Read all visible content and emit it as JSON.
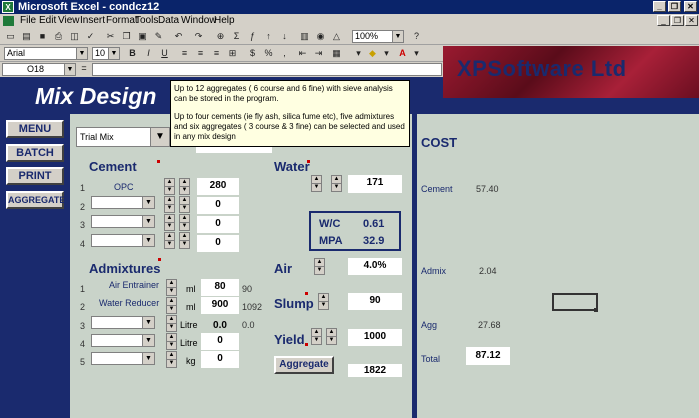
{
  "window": {
    "title": "Microsoft Excel - condcz12",
    "icon": "excel-icon"
  },
  "window_controls": [
    "_",
    "❐",
    "✕"
  ],
  "doc_controls": [
    "_",
    "❐",
    "✕"
  ],
  "menu": [
    "File",
    "Edit",
    "View",
    "Insert",
    "Format",
    "Tools",
    "Data",
    "Window",
    "Help"
  ],
  "toolbar": {
    "zoom": "100%",
    "font": "Arial",
    "font_size": "10",
    "bold": "B",
    "italic": "I",
    "underline": "U"
  },
  "name_box": "O18",
  "banner": {
    "text": "XPSoftware Ltd"
  },
  "page_title": "Mix Design",
  "nav": [
    "MENU",
    "BATCH",
    "PRINT",
    "AGGREGATE"
  ],
  "tooltip": {
    "line1": "Up to 12 aggregates ( 6 course and 6 fine)  with sieve analysis can be stored in the program.",
    "line2": "Up to four cements (ie fly ash, silica fume etc), five admixtures and six aggregates ( 3 course & 3 fine) can be selected and used in any mix design"
  },
  "trial_mix": "Trial Mix",
  "cement": {
    "title": "Cement",
    "rows": [
      {
        "num": "1",
        "name": "OPC",
        "value": "280"
      },
      {
        "num": "2",
        "name": "",
        "value": "0"
      },
      {
        "num": "3",
        "name": "",
        "value": "0"
      },
      {
        "num": "4",
        "name": "",
        "value": "0"
      }
    ]
  },
  "admixtures": {
    "title": "Admixtures",
    "rows": [
      {
        "num": "1",
        "name": "Air Entrainer",
        "unit": "ml",
        "value": "80",
        "extra": "90"
      },
      {
        "num": "2",
        "name": "Water Reducer",
        "unit": "ml",
        "value": "900",
        "extra": "1092"
      },
      {
        "num": "3",
        "name": "",
        "unit": "Litre",
        "value": "0.0",
        "extra": "0.0"
      },
      {
        "num": "4",
        "name": "",
        "unit": "Litre",
        "value": "0",
        "extra": ""
      },
      {
        "num": "5",
        "name": "",
        "unit": "kg",
        "value": "0",
        "extra": ""
      }
    ]
  },
  "water": {
    "title": "Water",
    "value": "171"
  },
  "wc": {
    "wc_label": "W/C",
    "wc_value": "0.61",
    "mpa_label": "MPA",
    "mpa_value": "32.9"
  },
  "air": {
    "title": "Air",
    "value": "4.0%"
  },
  "slump": {
    "title": "Slump",
    "value": "90"
  },
  "yield": {
    "title": "Yield",
    "value": "1000"
  },
  "aggregate": {
    "button": "Aggregate",
    "value": "1822"
  },
  "cost": {
    "title": "COST",
    "cement_label": "Cement",
    "cement_value": "57.40",
    "admix_label": "Admix",
    "admix_value": "2.04",
    "agg_label": "Agg",
    "agg_value": "27.68",
    "total_label": "Total",
    "total_value": "87.12"
  }
}
